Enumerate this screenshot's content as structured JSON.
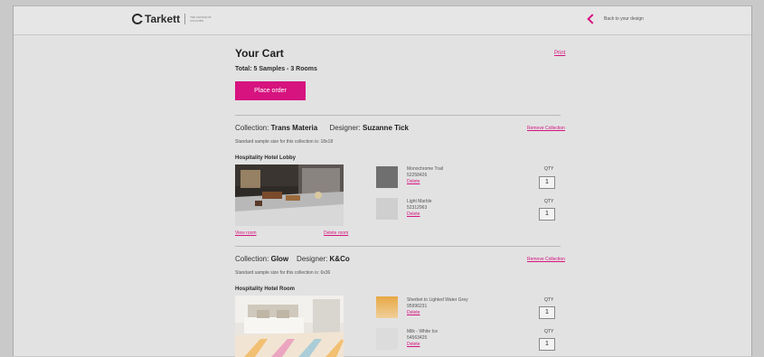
{
  "header": {
    "logo_text": "Tarkett",
    "tagline": "THE CHOICE OF COLOURS",
    "back_label": "Back to your design"
  },
  "cart": {
    "title": "Your Cart",
    "total": "Total: 5 Samples - 3 Rooms",
    "print_label": "Print",
    "place_order_label": "Place order"
  },
  "collections": [
    {
      "collection_label": "Collection:",
      "collection_name": "Trans Materia",
      "designer_label": "Designer:",
      "designer_name": "Suzanne Tick",
      "remove_label": "Remove Collection",
      "size_note": "Standard sample size for this collection is: 18x18",
      "room": {
        "name": "Hospitality Hotel Lobby",
        "view_label": "View room",
        "delete_label": "Delete room"
      },
      "products": [
        {
          "name": "Monochrome Trail",
          "code": "52258426",
          "delete_label": "Delete",
          "qty_label": "QTY",
          "qty": "1",
          "swatch_color": "#6f6f6f"
        },
        {
          "name": "Light Marble",
          "code": "52312963",
          "delete_label": "Delete",
          "qty_label": "QTY",
          "qty": "1",
          "swatch_color": "#cfcfcf"
        }
      ]
    },
    {
      "collection_label": "Collection:",
      "collection_name": "Glow",
      "designer_label": "Designer:",
      "designer_name": "K&Co",
      "remove_label": "Remove Collection",
      "size_note": "Standard sample size for this collection is: 6x36",
      "room": {
        "name": "Hospitality Hotel Room",
        "view_label": "View room",
        "delete_label": "Delete room"
      },
      "products": [
        {
          "name": "Sherbet to Lighted Water Grey",
          "code": "95996231",
          "delete_label": "Delete",
          "qty_label": "QTY",
          "qty": "1",
          "swatch_color": "#e7b25c"
        },
        {
          "name": "Milk - White Ice",
          "code": "54563425",
          "delete_label": "Delete",
          "qty_label": "QTY",
          "qty": "1",
          "swatch_color": "#dcdcdc"
        }
      ]
    }
  ],
  "colors": {
    "accent": "#d6137f",
    "page_bg": "#e2e2e2"
  }
}
